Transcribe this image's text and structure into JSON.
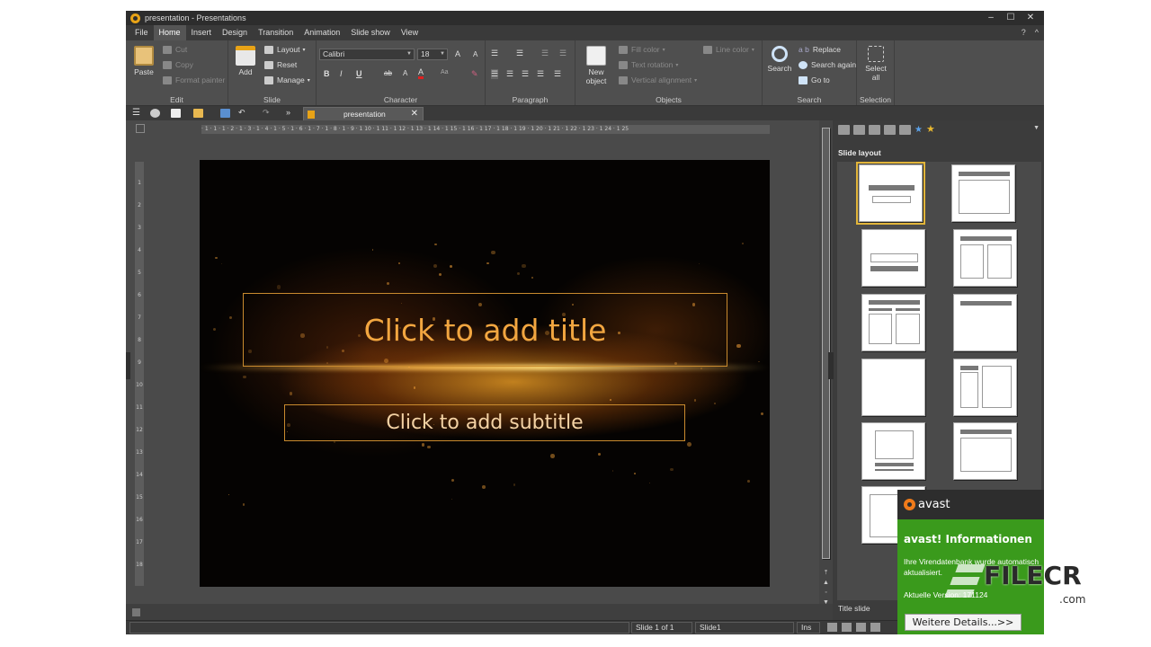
{
  "window": {
    "title": "presentation - Presentations",
    "controls": [
      "–",
      "☐",
      "✕"
    ]
  },
  "menu": {
    "items": [
      "File",
      "Home",
      "Insert",
      "Design",
      "Transition",
      "Animation",
      "Slide show",
      "View"
    ],
    "active": "Home",
    "help": "?",
    "collapse": "^"
  },
  "ribbon": {
    "edit": {
      "label": "Edit",
      "paste": "Paste",
      "cut": "Cut",
      "copy": "Copy",
      "format_painter": "Format painter"
    },
    "slide": {
      "label": "Slide",
      "add": "Add",
      "layout": "Layout",
      "reset": "Reset",
      "manage": "Manage"
    },
    "character": {
      "label": "Character",
      "font": "Calibri",
      "size": "18",
      "bold": "B",
      "italic": "I",
      "underline": "U"
    },
    "paragraph": {
      "label": "Paragraph"
    },
    "objects": {
      "label": "Objects",
      "new_object_1": "New",
      "new_object_2": "object",
      "fill_color": "Fill color",
      "text_rotation": "Text rotation",
      "vertical_alignment": "Vertical alignment",
      "line_color": "Line color"
    },
    "search": {
      "label": "Search",
      "search": "Search",
      "replace": "Replace",
      "search_again": "Search again",
      "go_to": "Go to"
    },
    "selection": {
      "label": "Selection",
      "select_1": "Select",
      "select_2": "all"
    }
  },
  "doc_tab": {
    "name": "presentation",
    "close": "✕"
  },
  "ruler": {
    "horizontal": "· 1 · 1 · 1 · 2 · 1 · 3 · 1 · 4 · 1 · 5 · 1 · 6 · 1 · 7 · 1 · 8 · 1 · 9 · 1 10 · 1 11 · 1 12 · 1 13 · 1 14 · 1 15 · 1 16 · 1 17 · 1 18 · 1 19 · 1 20 · 1 21 · 1 22 · 1 23 · 1 24 · 1 25",
    "vertical": [
      "1",
      "2",
      "3",
      "4",
      "5",
      "6",
      "7",
      "8",
      "9",
      "10",
      "11",
      "12",
      "13",
      "14",
      "15",
      "16",
      "17",
      "18"
    ]
  },
  "slide": {
    "title_placeholder": "Click to add title",
    "subtitle_placeholder": "Click to add subtitle"
  },
  "side_panel": {
    "title": "Slide layout",
    "selected_layout": "Title slide"
  },
  "status": {
    "slide_pos": "Slide 1 of 1",
    "slide_name": "Slide1",
    "mode": "Ins"
  },
  "avast": {
    "brand": "avast",
    "title": "avast! Informationen",
    "message_1": "Ihre Virendatenbank wurde automatisch",
    "message_2": "aktualisiert.",
    "version": "Aktuelle Version: 171124",
    "button": "Weitere Details...>>"
  },
  "watermark": {
    "text": "FILECR",
    "suffix": ".com"
  },
  "colors": {
    "accent": "#e8a317",
    "title_text": "#f2a640",
    "avast_green": "#3a9a1c",
    "avast_orange": "#f07b1a"
  }
}
